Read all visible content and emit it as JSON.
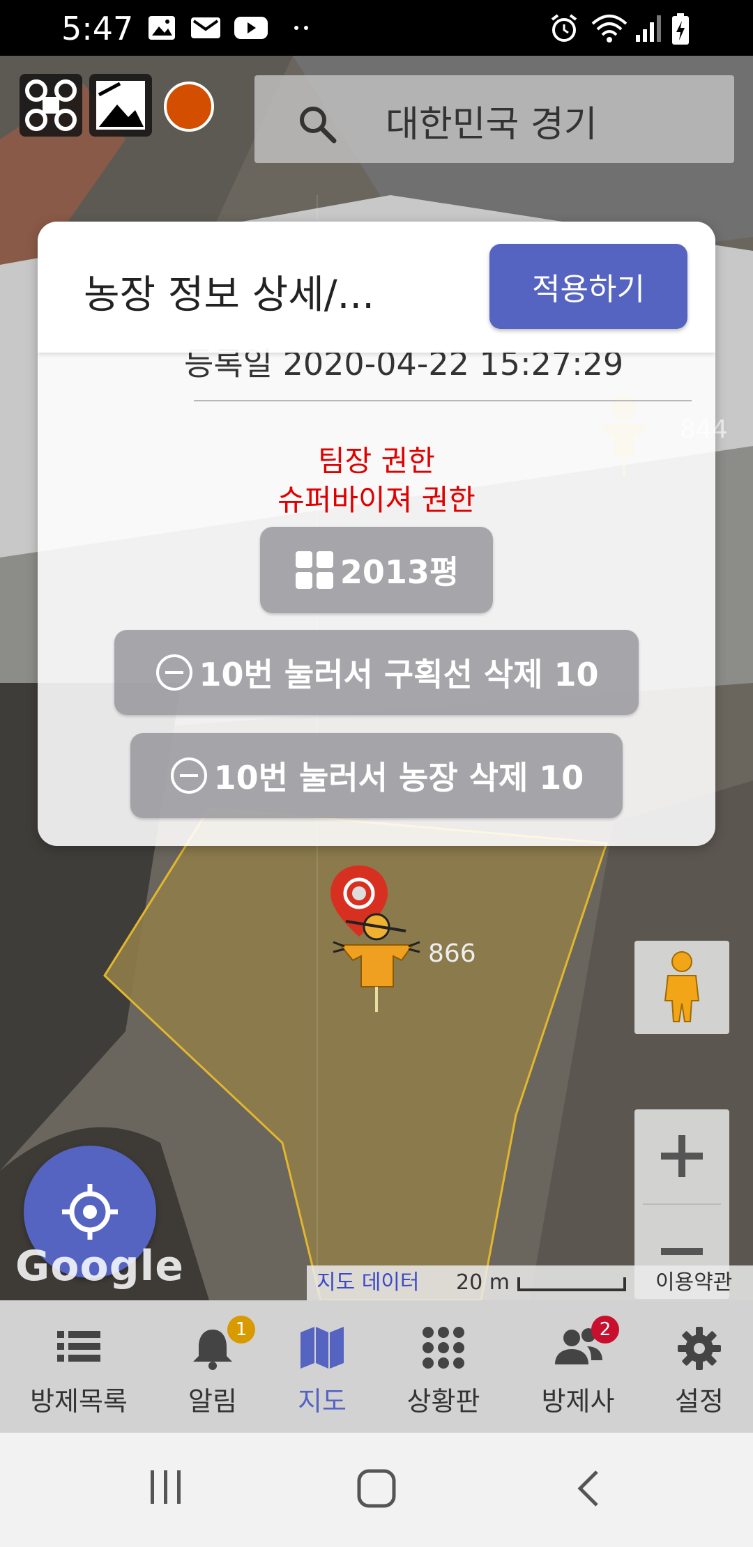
{
  "status_bar": {
    "time": "5:47"
  },
  "search": {
    "text": "대한민국 경기"
  },
  "dialog": {
    "title": "농장 정보 상세/...",
    "apply_label": "적용하기",
    "cut_text": "등록일 2020-04-22 15:27:29",
    "permission_1": "팀장 권한",
    "permission_2": "슈퍼바이져 권한",
    "area_label": "2013평",
    "delete_line_label": "10번 눌러서 구획선 삭제 10",
    "delete_farm_label": "10번 눌러서 농장 삭제 10"
  },
  "map": {
    "marker_label_1": "844",
    "marker_label_2": "866",
    "google_logo": "Google",
    "map_data_label": "지도 데이터",
    "scale_label": "20 m",
    "terms_label": "이용약관"
  },
  "bottom_nav": {
    "items": [
      {
        "label": "방제목록",
        "icon": "list-icon"
      },
      {
        "label": "알림",
        "icon": "bell-icon",
        "badge": "1"
      },
      {
        "label": "지도",
        "icon": "map-icon"
      },
      {
        "label": "상황판",
        "icon": "grid-icon"
      },
      {
        "label": "방제사",
        "icon": "people-icon",
        "badge": "2"
      },
      {
        "label": "설정",
        "icon": "gear-icon"
      }
    ]
  },
  "colors": {
    "accent": "#5563c1",
    "permission_text": "#e00000",
    "alert_badge": "#d99a00",
    "people_badge": "#c8102e"
  }
}
